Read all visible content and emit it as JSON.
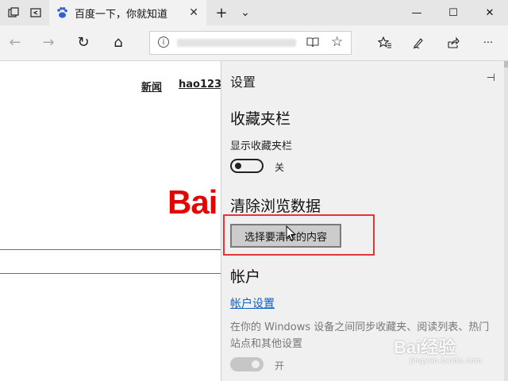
{
  "tab": {
    "title": "百度一下，你就知道",
    "close_glyph": "✕"
  },
  "tabbar": {
    "new_tab_glyph": "+",
    "dropdown_glyph": "⌄"
  },
  "window": {
    "minimize_glyph": "—",
    "maximize_glyph": "☐",
    "close_glyph": "✕"
  },
  "toolbar": {
    "back_glyph": "←",
    "forward_glyph": "→",
    "refresh_glyph": "↻",
    "home_glyph": "⌂",
    "more_glyph": "···"
  },
  "page": {
    "nav_links": [
      "新闻",
      "hao123"
    ],
    "logo_text": "Bai"
  },
  "settings": {
    "title": "设置",
    "pin_glyph": "⊣",
    "favorites_bar": {
      "heading": "收藏夹栏",
      "show_label": "显示收藏夹栏",
      "toggle_state": "关"
    },
    "clear_data": {
      "heading": "清除浏览数据",
      "button_label": "选择要清除的内容"
    },
    "account": {
      "heading": "帐户",
      "link_label": "帐户设置",
      "sync_description": "在你的 Windows 设备之间同步收藏夹、阅读列表、热门站点和其他设置",
      "sync_toggle_state": "开"
    }
  },
  "watermark": {
    "main": "Bai经验",
    "sub": "jingyan.baidu.com"
  },
  "colors": {
    "accent_link": "#0a62c9",
    "baidu_red": "#e10601",
    "highlight_red": "#e0363c",
    "search_border": "#3b78c7"
  }
}
